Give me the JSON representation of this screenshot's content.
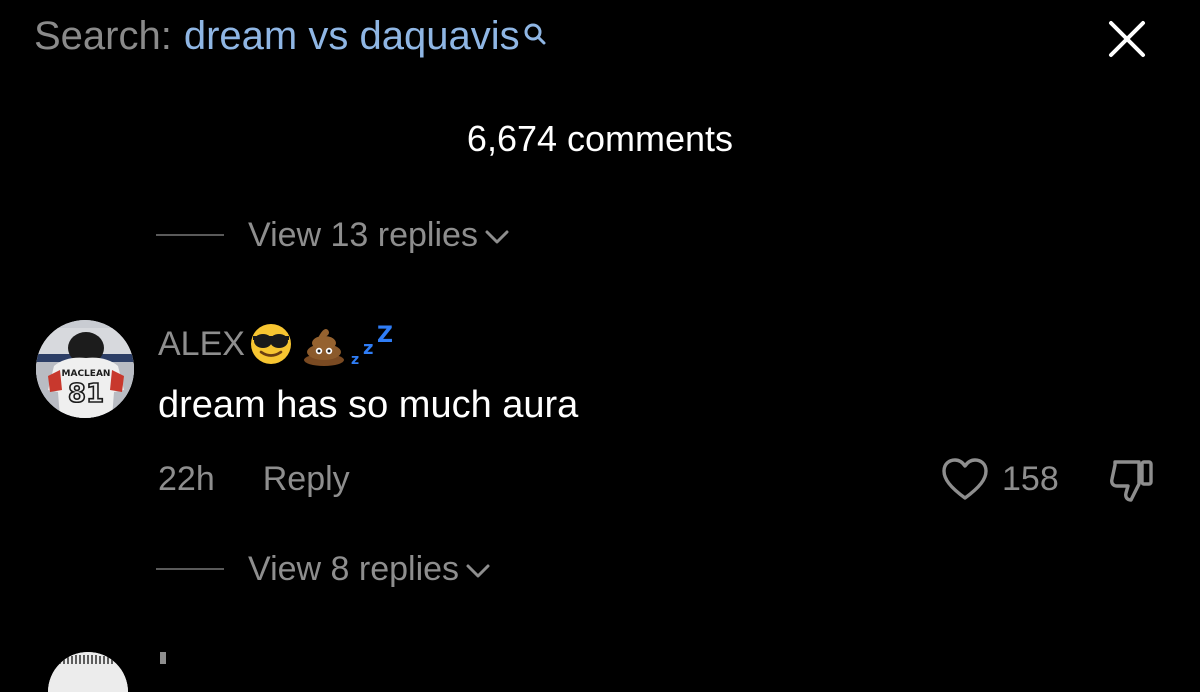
{
  "header": {
    "search_label": "Search:",
    "search_query": "dream vs daquavis",
    "search_icon": "search-icon",
    "close_icon": "close-icon"
  },
  "comments_count": "6,674 comments",
  "view_replies_top": {
    "label": "View 13 replies",
    "icon": "chevron-down-icon"
  },
  "comment": {
    "username": "ALEX",
    "username_emojis": [
      "sunglasses-emoji",
      "poop-emoji",
      "zzz-emoji"
    ],
    "avatar_jersey_name": "MACLEAN",
    "avatar_jersey_number": "81",
    "text": "dream has so much aura",
    "time": "22h",
    "reply_label": "Reply",
    "likes": "158",
    "like_icon": "heart-icon",
    "dislike_icon": "dislike-icon"
  },
  "view_replies_bottom": {
    "label": "View 8 replies",
    "icon": "chevron-down-icon"
  },
  "colors": {
    "background": "#000000",
    "muted_text": "#8e8e8e",
    "query_blue": "#8fb6e4",
    "zzz_blue": "#2f7df6"
  }
}
